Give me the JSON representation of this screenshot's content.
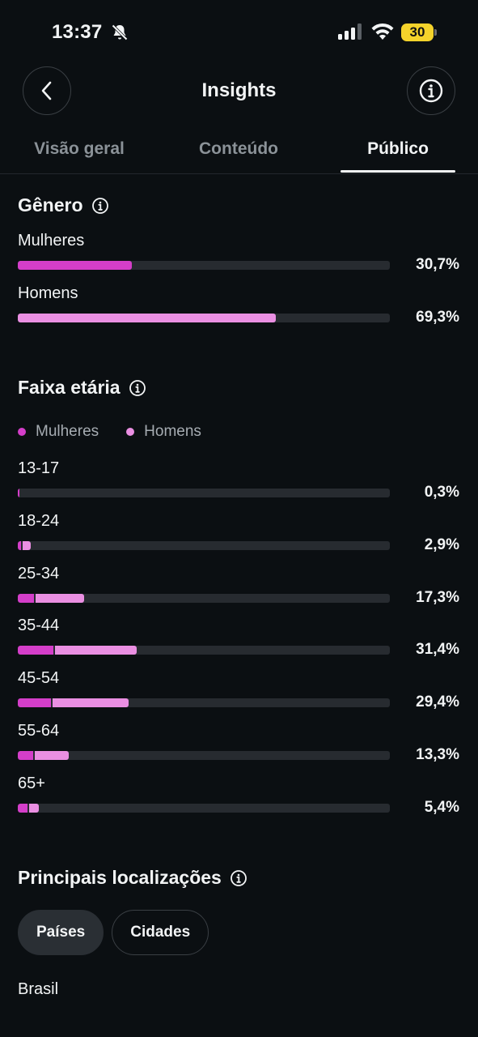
{
  "status": {
    "time": "13:37",
    "battery": "30"
  },
  "nav": {
    "title": "Insights"
  },
  "tabs": [
    {
      "label": "Visão geral",
      "active": false
    },
    {
      "label": "Conteúdo",
      "active": false
    },
    {
      "label": "Público",
      "active": true
    }
  ],
  "gender": {
    "title": "Gênero",
    "rows": [
      {
        "label": "Mulheres",
        "percent_text": "30,7%",
        "value": 30.7
      },
      {
        "label": "Homens",
        "percent_text": "69,3%",
        "value": 69.3
      }
    ]
  },
  "age": {
    "title": "Faixa etária",
    "legend": {
      "women": "Mulheres",
      "men": "Homens"
    },
    "rows": [
      {
        "label": "13-17",
        "percent_text": "0,3%",
        "total": 0.3,
        "women": 0.3,
        "men": 0.0
      },
      {
        "label": "18-24",
        "percent_text": "2,9%",
        "total": 2.9,
        "women": 0.8,
        "men": 2.1
      },
      {
        "label": "25-34",
        "percent_text": "17,3%",
        "total": 17.3,
        "women": 4.3,
        "men": 13.0
      },
      {
        "label": "35-44",
        "percent_text": "31,4%",
        "total": 31.4,
        "women": 9.5,
        "men": 21.9
      },
      {
        "label": "45-54",
        "percent_text": "29,4%",
        "total": 29.4,
        "women": 9.0,
        "men": 20.4
      },
      {
        "label": "55-64",
        "percent_text": "13,3%",
        "total": 13.3,
        "women": 4.1,
        "men": 9.2
      },
      {
        "label": "65+",
        "percent_text": "5,4%",
        "total": 5.4,
        "women": 2.7,
        "men": 2.7
      }
    ]
  },
  "locations": {
    "title": "Principais localizações",
    "chips": [
      {
        "label": "Países",
        "selected": true
      },
      {
        "label": "Cidades",
        "selected": false
      }
    ],
    "first_item": "Brasil"
  },
  "colors": {
    "women": "#d43ec9",
    "men": "#ea8fe2",
    "track": "#272b30",
    "background": "#0b0f12"
  }
}
